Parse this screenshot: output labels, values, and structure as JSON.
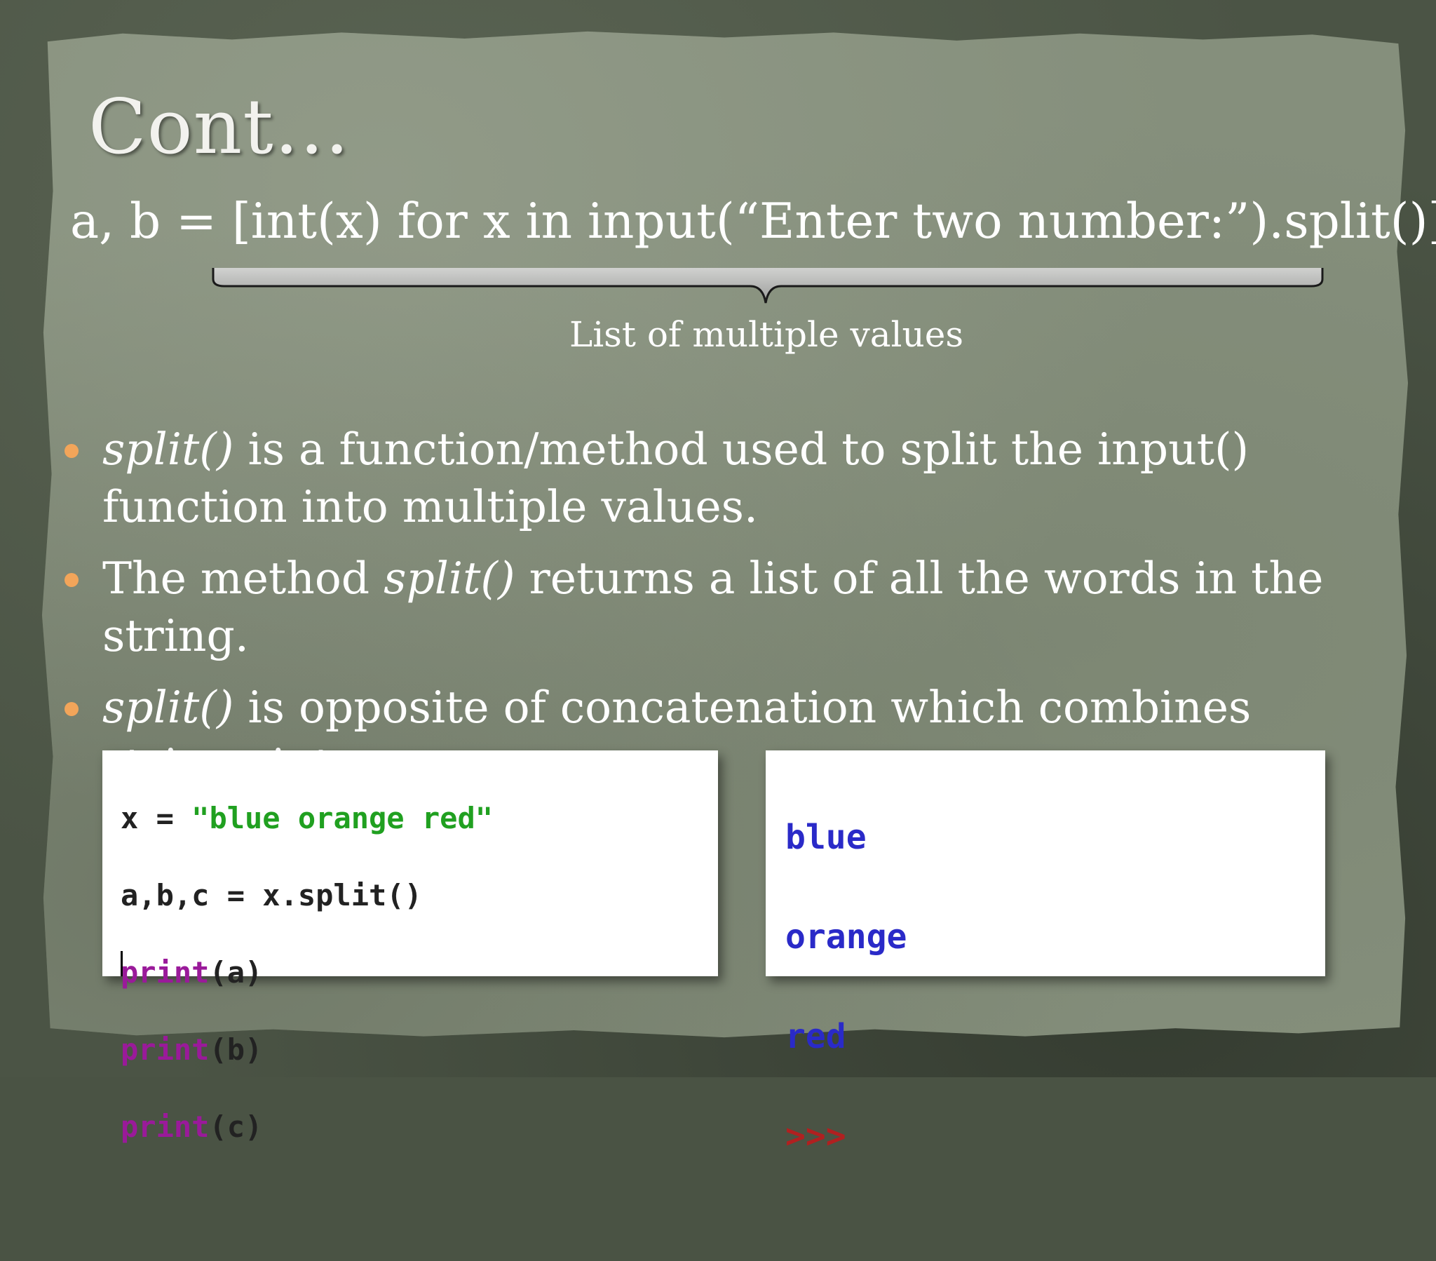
{
  "slide": {
    "title": "Cont…",
    "code_line": "a, b = [int(x) for x in input(“Enter two number:”).split()]",
    "brace_label": "List of multiple values",
    "bullets": [
      {
        "lead": "split()",
        "rest": " is a function/method used to split the input() function into multiple values."
      },
      {
        "pre": "The method ",
        "lead": "split()",
        "rest": " returns a list of all the words in the string."
      },
      {
        "lead": "split()",
        "rest": " is opposite of concatenation which combines strings into one."
      }
    ],
    "accent_color": "#f2a55a"
  },
  "code_example": {
    "line1_var": "x = ",
    "line1_str": "\"blue orange red\"",
    "line2": "a,b,c = x.split()",
    "line3_kw": "print",
    "line3_arg": "(a)",
    "line4_kw": "print",
    "line4_arg": "(b)",
    "line5_kw": "print",
    "line5_arg": "(c)"
  },
  "output": {
    "line1": "blue",
    "line2": "orange",
    "line3": "red",
    "prompt": ">>>"
  }
}
